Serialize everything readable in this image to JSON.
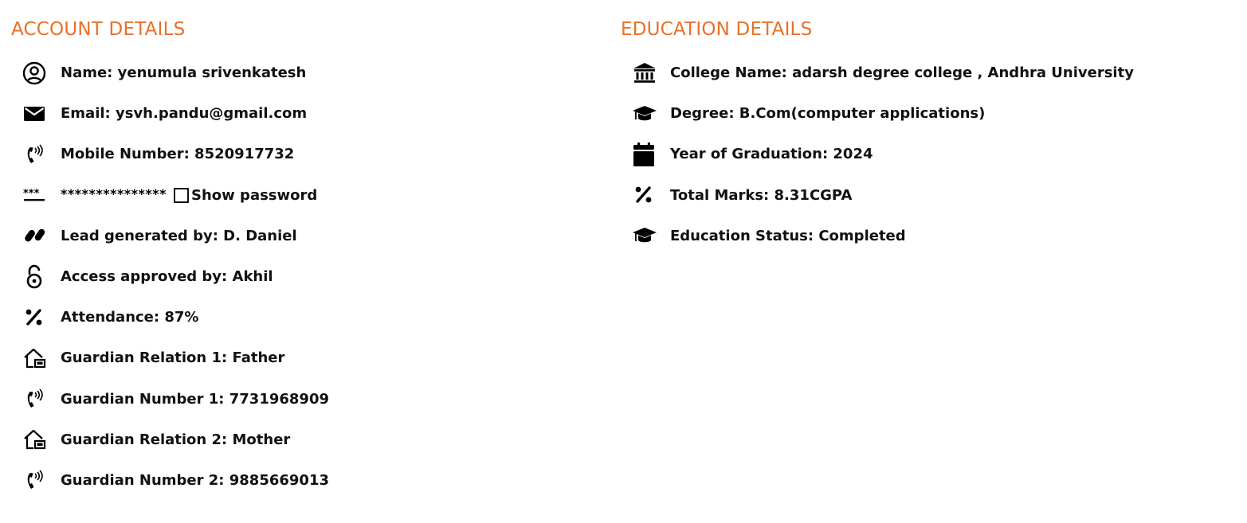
{
  "account": {
    "title": "ACCOUNT DETAILS",
    "name": "Name: yenumula srivenkatesh",
    "email": "Email: ysvh.pandu@gmail.com",
    "mobile": "Mobile Number: 8520917732",
    "password_mask": "***************",
    "show_password_label": "Show password",
    "lead": "Lead generated by: D. Daniel",
    "access": "Access approved by: Akhil",
    "attendance": "Attendance: 87%",
    "guardian_relation_1": "Guardian Relation 1: Father",
    "guardian_number_1": "Guardian Number 1: 7731968909",
    "guardian_relation_2": "Guardian Relation 2: Mother",
    "guardian_number_2": "Guardian Number 2: 9885669013"
  },
  "education": {
    "title": "EDUCATION DETAILS",
    "college": "College Name: adarsh degree college , Andhra University",
    "degree": "Degree: B.Com(computer applications)",
    "year": "Year of Graduation: 2024",
    "marks": "Total Marks: 8.31CGPA",
    "status": "Education Status: Completed"
  },
  "icons": {
    "name": "user-circle-icon",
    "email": "envelope-icon",
    "mobile": "phone-ringing-icon",
    "password": "password-asterisks-icon",
    "lead": "pills-icon",
    "access": "open-lock-icon",
    "attendance": "percent-icon",
    "guardian_relation": "home-user-icon",
    "guardian_number": "phone-ringing-icon",
    "college": "institution-icon",
    "degree": "graduation-cap-icon",
    "year": "calendar-icon",
    "marks": "percent-icon",
    "status": "graduation-cap-icon"
  },
  "colors": {
    "heading": "#E8702A",
    "text": "#111111"
  }
}
